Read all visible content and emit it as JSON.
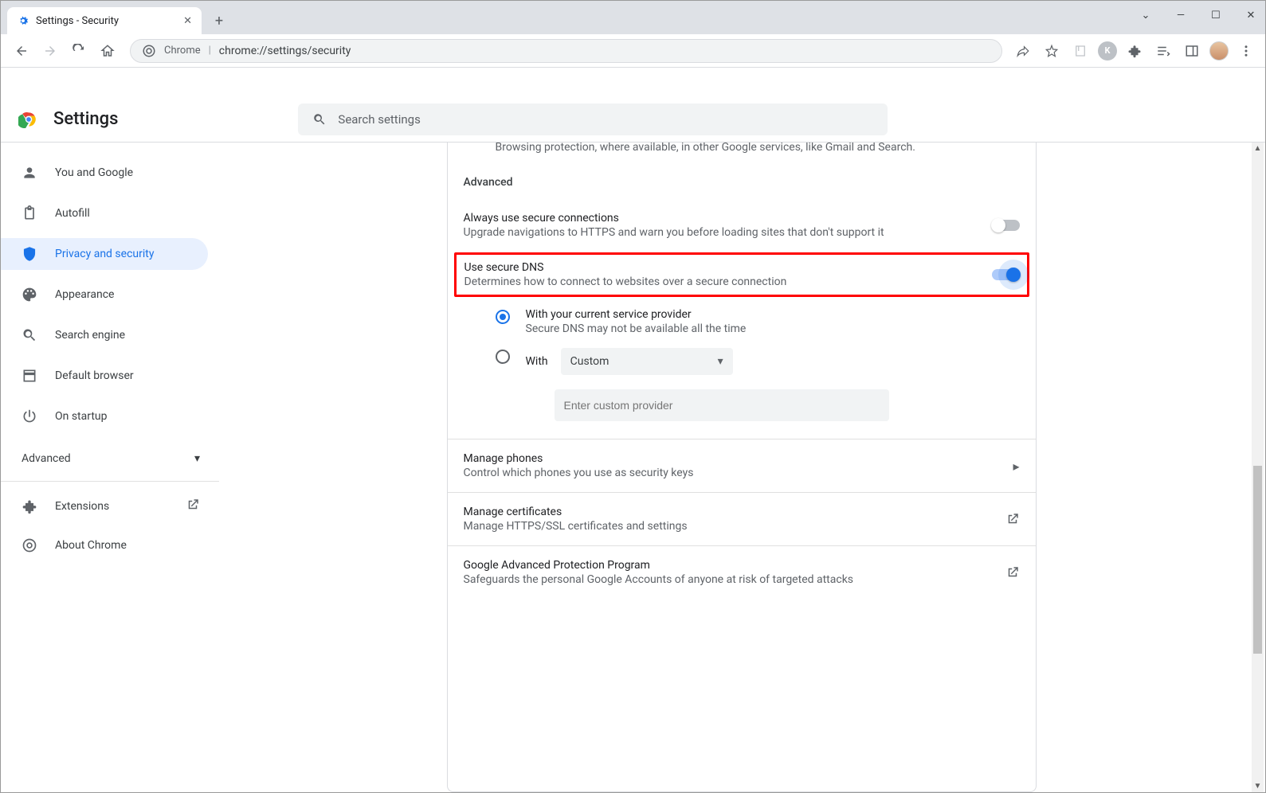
{
  "window": {
    "tab_title": "Settings - Security"
  },
  "omnibox": {
    "origin_label": "Chrome",
    "url": "chrome://settings/security"
  },
  "header": {
    "title": "Settings",
    "search_placeholder": "Search settings"
  },
  "sidebar": {
    "items": [
      {
        "label": "You and Google"
      },
      {
        "label": "Autofill"
      },
      {
        "label": "Privacy and security"
      },
      {
        "label": "Appearance"
      },
      {
        "label": "Search engine"
      },
      {
        "label": "Default browser"
      },
      {
        "label": "On startup"
      }
    ],
    "advanced_label": "Advanced",
    "extensions_label": "Extensions",
    "about_label": "About Chrome"
  },
  "main": {
    "cutoff_text": "Browsing protection, where available, in other Google services, like Gmail and Search.",
    "section_title": "Advanced",
    "secure_conn": {
      "title": "Always use secure connections",
      "sub": "Upgrade navigations to HTTPS and warn you before loading sites that don't support it",
      "on": false
    },
    "secure_dns": {
      "title": "Use secure DNS",
      "sub": "Determines how to connect to websites over a secure connection",
      "on": true,
      "opt1": {
        "title": "With your current service provider",
        "sub": "Secure DNS may not be available all the time"
      },
      "opt2_label": "With",
      "dropdown_value": "Custom",
      "custom_placeholder": "Enter custom provider"
    },
    "links": [
      {
        "title": "Manage phones",
        "sub": "Control which phones you use as security keys",
        "action": "chevron"
      },
      {
        "title": "Manage certificates",
        "sub": "Manage HTTPS/SSL certificates and settings",
        "action": "launch"
      },
      {
        "title": "Google Advanced Protection Program",
        "sub": "Safeguards the personal Google Accounts of anyone at risk of targeted attacks",
        "action": "launch"
      }
    ]
  },
  "avatar_letter": "K"
}
